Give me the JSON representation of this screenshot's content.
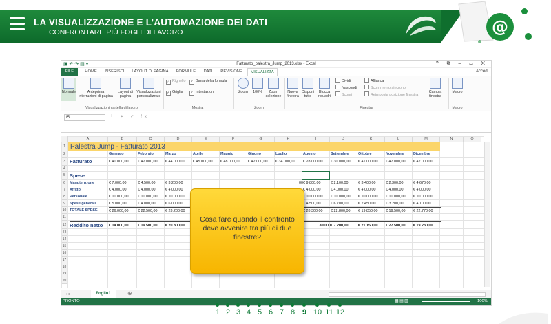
{
  "banner": {
    "title": "LA VISUALIZZAZIONE E L’AUTOMAZIONE DEI DATI",
    "subtitle": "CONFRONTARE PIÙ FOGLI DI LAVORO",
    "logo_symbol": "@",
    "accent_color": "#1b8f3c"
  },
  "excel": {
    "file_title": "Fatturato_palestra_Jump_2013.xlsx - Excel",
    "window_controls": "? ⧉ – ▭ ✕",
    "sign_in": "Accedi",
    "tabs": [
      "FILE",
      "HOME",
      "INSERISCI",
      "LAYOUT DI PAGINA",
      "FORMULE",
      "DATI",
      "REVISIONE",
      "VISUALIZZA"
    ],
    "ribbon": {
      "normale": "Normale",
      "anteprima": "Anteprima interruzioni di pagina",
      "layout": "Layout di pagina",
      "visualizzazioni": "Visualizzazioni personalizzate",
      "group1": "Visualizzazioni cartella di lavoro",
      "righello": "Righello",
      "barra_formula": "Barra della formula",
      "griglia": "Griglia",
      "intestazioni": "Intestazioni",
      "group2": "Mostra",
      "zoom": "Zoom",
      "zoom100": "100%",
      "zoom_sel": "Zoom selezione",
      "group3": "Zoom",
      "nuova": "Nuova finestra",
      "disponi": "Disponi tutto",
      "blocca": "Blocca riquadri",
      "dividi": "Dividi",
      "nascondi": "Nascondi",
      "scopri": "Scopri",
      "affianca": "Affianca",
      "scorrimento": "Scorrimento sincrono",
      "reimposta": "Reimposta posizione finestra",
      "cambia": "Cambia finestra",
      "group4": "Finestra",
      "macro": "Macro",
      "group5": "Macro"
    },
    "name_box": "I5",
    "fx": "fx",
    "columns": [
      "A",
      "B",
      "C",
      "D",
      "E",
      "F",
      "G",
      "H",
      "I",
      "J",
      "K",
      "L",
      "M",
      "N",
      "O"
    ],
    "rows": [
      "1",
      "2",
      "3",
      "4",
      "5",
      "6",
      "7",
      "8",
      "9",
      "10",
      "11",
      "12",
      "13",
      "14",
      "15",
      "16",
      "17",
      "18",
      "19",
      "20"
    ],
    "sheet_title": "Palestra Jump - Fatturato 2013",
    "months": [
      "Gennaio",
      "Febbraio",
      "Marzo",
      "Aprile",
      "Maggio",
      "Giugno",
      "Luglio",
      "Agosto",
      "Settembre",
      "Ottobre",
      "Novembre",
      "Dicembre"
    ],
    "fatturato_label": "Fatturato",
    "fatturato": [
      "€ 40.000,00",
      "€ 42.000,00",
      "€ 44.000,00",
      "€ 45.000,00",
      "€ 48.000,00",
      "€ 42.000,00",
      "€ 34.000,00",
      "€ 28.000,00",
      "€ 30.000,00",
      "€ 41.000,00",
      "€ 47.000,00",
      "€ 42.000,00"
    ],
    "spese_label": "Spese",
    "expense_rows": [
      {
        "label": "Manutenzione",
        "b": "€   7.000,00",
        "c": "€   4.500,00",
        "d": "€   3.200,00",
        "h": "00",
        "i": "€   9.800,00",
        "j": "€   2.100,00",
        "k": "€   3.400,00",
        "l": "€   2.300,00",
        "m": "€   4.670,00"
      },
      {
        "label": "Affitto",
        "b": "€   4.000,00",
        "c": "€   4.000,00",
        "d": "€   4.000,00",
        "h": "",
        "i": "€   4.000,00",
        "j": "€   4.000,00",
        "k": "€   4.000,00",
        "l": "€   4.000,00",
        "m": "€   4.000,00"
      },
      {
        "label": "Personale",
        "b": "€ 10.000,00",
        "c": "€ 10.000,00",
        "d": "€ 10.000,00",
        "h": "",
        "i": "€ 10.000,00",
        "j": "€ 10.000,00",
        "k": "€ 10.000,00",
        "l": "€ 10.000,00",
        "m": "€ 10.000,00"
      },
      {
        "label": "Spese generali",
        "b": "€   5.000,00",
        "c": "€   4.000,00",
        "d": "€   6.000,00",
        "h": "",
        "i": "€   4.500,00",
        "j": "€   6.700,00",
        "k": "€   2.450,00",
        "l": "€   3.200,00",
        "m": "€   4.100,00"
      },
      {
        "label": "TOTALE SPESE",
        "b": "€ 26.000,00",
        "c": "€ 22.500,00",
        "d": "€ 23.200,00",
        "h": "",
        "i": "€ 28.300,00",
        "j": "€ 22.800,00",
        "k": "€ 19.850,00",
        "l": "€ 19.500,00",
        "m": "€ 22.770,00"
      }
    ],
    "reddito_label": "Reddito netto",
    "reddito": {
      "b": "€ 14.000,00",
      "c": "€ 19.500,00",
      "d": "€ 20.800,00",
      "i": "300,00",
      "j": "€   7.200,00",
      "k": "€ 21.150,00",
      "l": "€ 27.500,00",
      "m": "€ 19.230,00"
    },
    "sheet_tab": "Foglio1",
    "status": "PRONTO",
    "zoom_level": "100%"
  },
  "callout": "Cosa fare quando il confronto deve avvenire tra più di due finestre?",
  "pager": {
    "pages": [
      "1",
      "2",
      "3",
      "4",
      "5",
      "6",
      "7",
      "8",
      "9",
      "10",
      "11",
      "12"
    ],
    "current": "9"
  }
}
